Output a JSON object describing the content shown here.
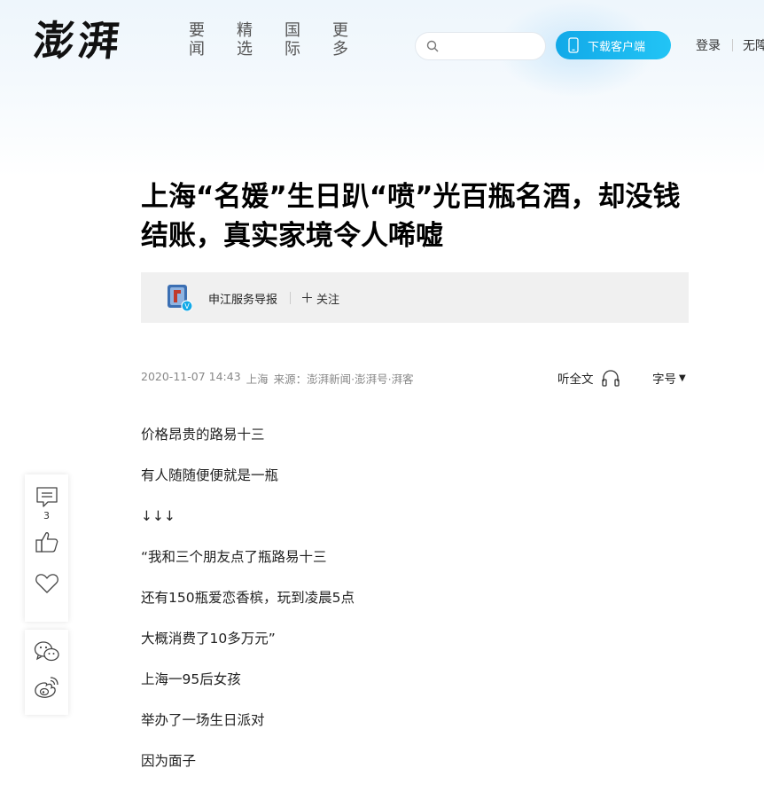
{
  "header": {
    "logo_text": "澎湃",
    "nav": [
      "要闻",
      "精选",
      "国际",
      "更多"
    ],
    "search": {
      "placeholder": ""
    },
    "download_label": "下载客户端",
    "login_label": "登录",
    "barrier_label": "无障"
  },
  "article": {
    "title": "上海“名媛”生日趴“喷”光百瓶名酒，却没钱结账，真实家境令人唏嘘",
    "author": {
      "name": "申江服务导报",
      "follow_label": "关注",
      "verified_badge": "V"
    },
    "meta": {
      "datetime": "2020-11-07 14:43",
      "location": "上海",
      "source": "来源：澎湃新闻·澎湃号·湃客"
    },
    "listen_label": "听全文",
    "fontsize_label": "字号",
    "paragraphs": [
      "价格昂贵的路易十三",
      "有人随随便便就是一瓶",
      "↓↓↓",
      "“我和三个朋友点了瓶路易十三",
      "还有150瓶爱恋香槟，玩到凌晨5点",
      "大概消费了10多万元”",
      "上海一95后女孩",
      "举办了一场生日派对",
      "因为面子"
    ]
  },
  "side_actions": {
    "comment_count": "3"
  },
  "colors": {
    "accent": "#12a9e8",
    "author_bar_bg": "#f0f0f0",
    "meta_text": "#888888"
  },
  "icons": [
    "search-icon",
    "phone-icon",
    "plus-icon",
    "headphone-icon",
    "caret-down-icon",
    "comment-icon",
    "thumbs-up-icon",
    "heart-icon",
    "wechat-icon",
    "weibo-icon"
  ]
}
